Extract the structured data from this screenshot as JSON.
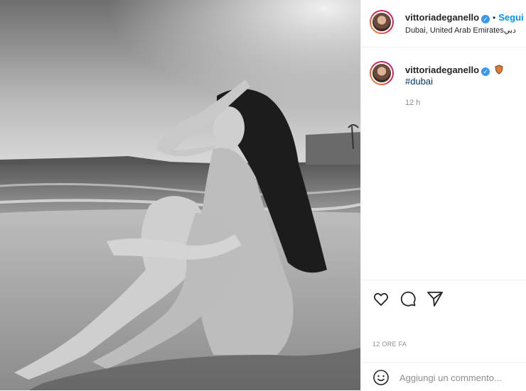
{
  "post": {
    "username": "vittoriadeganello",
    "follow_label": "Segui",
    "separator": "•",
    "location": "Dubai, United Arab Emiratesدبي"
  },
  "caption": {
    "username": "vittoriadeganello",
    "hashtag": "#dubai",
    "time": "12 h"
  },
  "actions": {
    "like_icon": "heart-icon",
    "comment_icon": "comment-icon",
    "share_icon": "share-icon"
  },
  "footer": {
    "date": "12 ORE FA",
    "comment_placeholder": "Aggiungi un commento..."
  },
  "colors": {
    "link": "#0095f6",
    "hashtag": "#00376b",
    "verified": "#3897f0",
    "muted": "#8e8e8e"
  }
}
